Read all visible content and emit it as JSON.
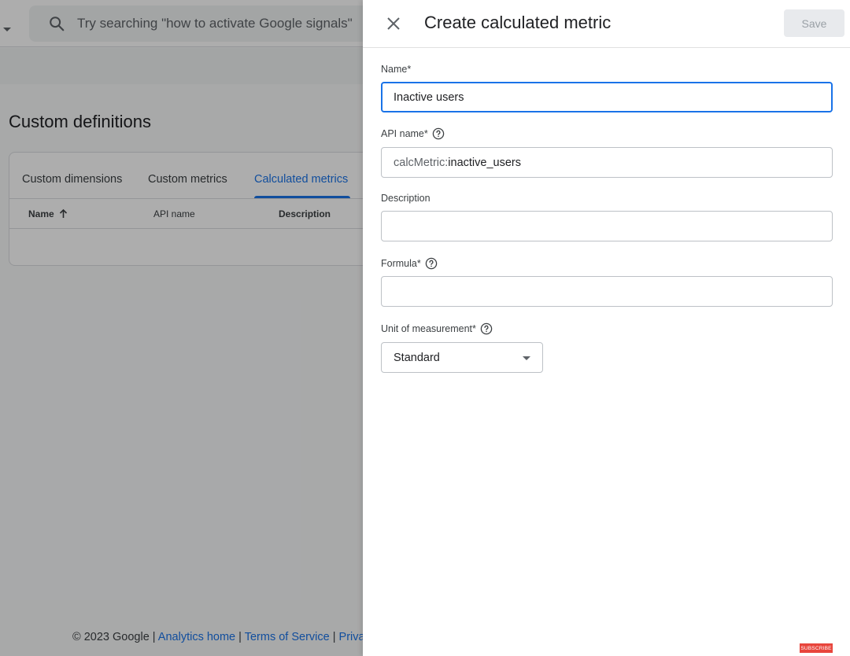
{
  "background": {
    "search_placeholder": "Try searching \"how to activate Google signals\"",
    "page_title": "Custom definitions",
    "tabs": [
      {
        "label": "Custom dimensions",
        "active": false
      },
      {
        "label": "Custom metrics",
        "active": false
      },
      {
        "label": "Calculated metrics",
        "active": true
      }
    ],
    "columns": [
      "Name",
      "API name",
      "Description"
    ],
    "footer": {
      "copyright": "© 2023 Google |",
      "link1": "Analytics home",
      "sep1": "|",
      "link2": "Terms of Service",
      "sep2": "|",
      "link3_partial": "Priva"
    }
  },
  "panel": {
    "title": "Create calculated metric",
    "save_label": "Save",
    "fields": {
      "name": {
        "label": "Name*",
        "value": "Inactive users"
      },
      "api_name": {
        "label": "API name*",
        "prefix": "calcMetric:",
        "value": "inactive_users"
      },
      "description": {
        "label": "Description",
        "value": ""
      },
      "formula": {
        "label": "Formula*",
        "value": ""
      },
      "unit": {
        "label": "Unit of measurement*",
        "value": "Standard"
      }
    }
  },
  "badge": "SUBSCRIBE",
  "colors": {
    "accent": "#1a73e8",
    "scrim": "rgba(0,0,0,0.32)"
  },
  "icons": [
    "search-icon",
    "chevron-down-icon",
    "arrow-up-icon",
    "close-icon",
    "help-icon",
    "dropdown-caret-icon"
  ]
}
